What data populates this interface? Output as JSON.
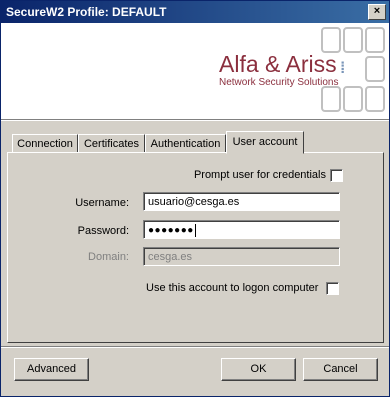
{
  "window": {
    "title": "SecureW2 Profile: DEFAULT",
    "close_glyph": "×"
  },
  "logo": {
    "name": "Alfa & Ariss",
    "tagline": "Network Security Solutions"
  },
  "tabs": [
    {
      "label": "Connection"
    },
    {
      "label": "Certificates"
    },
    {
      "label": "Authentication"
    },
    {
      "label": "User account",
      "active": true
    }
  ],
  "user_account": {
    "prompt_label": "Prompt user for credentials",
    "prompt_checked": false,
    "username_label": "Username:",
    "username_value": "usuario@cesga.es",
    "password_label": "Password:",
    "password_mask": "●●●●●●●",
    "domain_label": "Domain:",
    "domain_value": "cesga.es",
    "logon_label": "Use this account to logon computer",
    "logon_checked": false
  },
  "buttons": {
    "advanced": "Advanced",
    "ok": "OK",
    "cancel": "Cancel"
  }
}
